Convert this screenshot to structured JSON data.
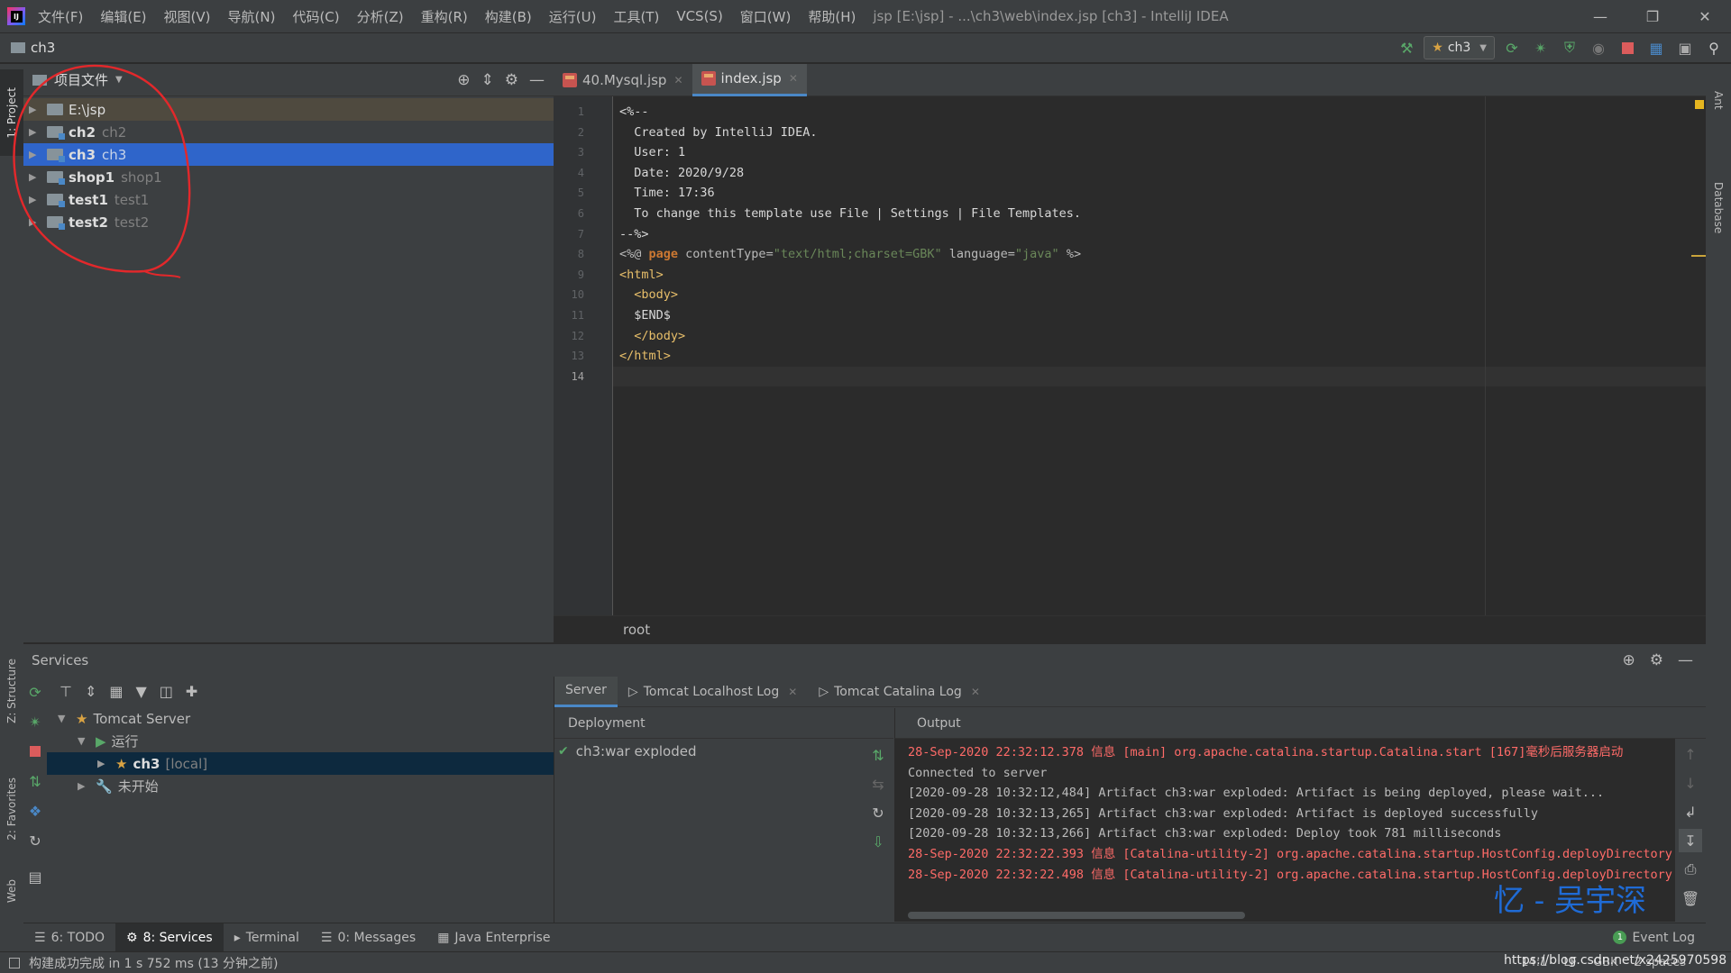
{
  "titlebar": {
    "app_icon": "intellij-idea-icon",
    "menu": [
      "文件(F)",
      "编辑(E)",
      "视图(V)",
      "导航(N)",
      "代码(C)",
      "分析(Z)",
      "重构(R)",
      "构建(B)",
      "运行(U)",
      "工具(T)",
      "VCS(S)",
      "窗口(W)",
      "帮助(H)"
    ],
    "title": "jsp [E:\\jsp] - ...\\ch3\\web\\index.jsp [ch3] - IntelliJ IDEA"
  },
  "navbar": {
    "project": "ch3",
    "run_config": "ch3"
  },
  "left_stripe": {
    "project": "1: Project",
    "structure": "Z: Structure",
    "favorites": "2: Favorites",
    "web": "Web"
  },
  "right_stripe": {
    "ant": "Ant",
    "database": "Database"
  },
  "project_panel": {
    "view": "项目文件",
    "tree": [
      {
        "name": "E:\\jsp",
        "sub": "",
        "selected": false,
        "highlight": true
      },
      {
        "name": "ch2",
        "sub": "ch2",
        "selected": false,
        "highlight": false
      },
      {
        "name": "ch3",
        "sub": "ch3",
        "selected": true,
        "highlight": false
      },
      {
        "name": "shop1",
        "sub": "shop1",
        "selected": false,
        "highlight": false
      },
      {
        "name": "test1",
        "sub": "test1",
        "selected": false,
        "highlight": false
      },
      {
        "name": "test2",
        "sub": "test2",
        "selected": false,
        "highlight": false
      }
    ]
  },
  "editor": {
    "tabs": [
      {
        "label": "40.Mysql.jsp",
        "active": false
      },
      {
        "label": "index.jsp",
        "active": true
      }
    ],
    "line_numbers": [
      "1",
      "2",
      "3",
      "4",
      "5",
      "6",
      "7",
      "8",
      "9",
      "10",
      "11",
      "12",
      "13",
      "14"
    ],
    "lines": {
      "l1": "<%--",
      "l2": "  Created by IntelliJ IDEA.",
      "l3": "  User: 1",
      "l4": "  Date: 2020/9/28",
      "l5": "  Time: 17:36",
      "l6": "  To change this template use File | Settings | File Templates.",
      "l7": "--%>",
      "l8_open": "<%@ ",
      "l8_kw": "page",
      "l8_attr1": " contentType=",
      "l8_val1": "\"text/html;charset=GBK\"",
      "l8_attr2": " language=",
      "l8_val2": "\"java\"",
      "l8_close": " %>",
      "l9": "<html>",
      "l10": "  <body>",
      "l11": "  $END$",
      "l12": "  </body>",
      "l13": "</html>"
    },
    "breadcrumb": "root"
  },
  "services": {
    "title": "Services",
    "tree": {
      "server": "Tomcat Server",
      "running": "运行",
      "app": "ch3",
      "app_sub": "[local]",
      "not_started": "未开始"
    },
    "tabs": [
      {
        "label": "Server",
        "active": true
      },
      {
        "label": "Tomcat Localhost Log",
        "active": false
      },
      {
        "label": "Tomcat Catalina Log",
        "active": false
      }
    ],
    "deployment_header": "Deployment",
    "deployment_item": "ch3:war exploded",
    "output_header": "Output",
    "output": [
      {
        "text": "28-Sep-2020 22:32:12.378 信息 [main] org.apache.catalina.startup.Catalina.start [167]毫秒后服务器启动",
        "level": "err"
      },
      {
        "text": "Connected to server",
        "level": "info"
      },
      {
        "text": "[2020-09-28 10:32:12,484] Artifact ch3:war exploded: Artifact is being deployed, please wait...",
        "level": "info"
      },
      {
        "text": "[2020-09-28 10:32:13,265] Artifact ch3:war exploded: Artifact is deployed successfully",
        "level": "info"
      },
      {
        "text": "[2020-09-28 10:32:13,266] Artifact ch3:war exploded: Deploy took 781 milliseconds",
        "level": "info"
      },
      {
        "text": "28-Sep-2020 22:32:22.393 信息 [Catalina-utility-2] org.apache.catalina.startup.HostConfig.deployDirectory 把",
        "level": "err"
      },
      {
        "text": "28-Sep-2020 22:32:22.498 信息 [Catalina-utility-2] org.apache.catalina.startup.HostConfig.deployDirectory W",
        "level": "err"
      }
    ]
  },
  "bottom_tabs": [
    {
      "label": "6: TODO",
      "active": false,
      "icon": "list-icon"
    },
    {
      "label": "8: Services",
      "active": true,
      "icon": "services-icon"
    },
    {
      "label": "Terminal",
      "active": false,
      "icon": "terminal-icon"
    },
    {
      "label": "0: Messages",
      "active": false,
      "icon": "messages-icon"
    },
    {
      "label": "Java Enterprise",
      "active": false,
      "icon": "java-enterprise-icon"
    }
  ],
  "event_log": {
    "count": "1",
    "label": "Event Log"
  },
  "statusbar": {
    "message": "构建成功完成 in 1 s 752 ms (13 分钟之前)",
    "position": "14:1",
    "line_sep": "LF",
    "encoding": "GBK",
    "indent": "2 spaces"
  },
  "watermark": {
    "signature": "忆 - 吴宇深",
    "url": "https://blog.csdn.net/x2425970598"
  }
}
